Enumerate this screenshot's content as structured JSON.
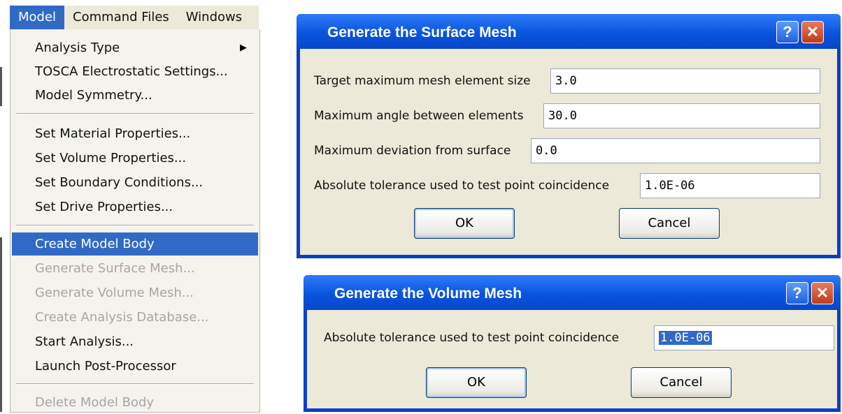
{
  "menubar": {
    "items": [
      "Model",
      "Command Files",
      "Windows"
    ],
    "active_index": 0
  },
  "menu": {
    "items": [
      {
        "label": "Analysis Type",
        "submenu": true
      },
      {
        "label": "TOSCA Electrostatic Settings..."
      },
      {
        "label": "Model Symmetry..."
      },
      {
        "label": "Set Material Properties..."
      },
      {
        "label": "Set Volume Properties..."
      },
      {
        "label": "Set Boundary Conditions..."
      },
      {
        "label": "Set Drive Properties..."
      },
      {
        "label": "Create Model Body",
        "highlighted": true
      },
      {
        "label": "Generate Surface Mesh...",
        "disabled": true
      },
      {
        "label": "Generate Volume Mesh...",
        "disabled": true
      },
      {
        "label": "Create Analysis Database...",
        "disabled": true
      },
      {
        "label": "Start Analysis..."
      },
      {
        "label": "Launch Post-Processor"
      },
      {
        "label": "Delete Model Body",
        "disabled": true
      }
    ],
    "submenu_arrow_icon": "triangle-right-icon"
  },
  "surface_dialog": {
    "title": "Generate the Surface Mesh",
    "fields": [
      {
        "label": "Target maximum mesh element size",
        "value": "3.0"
      },
      {
        "label": "Maximum angle between elements",
        "value": "30.0"
      },
      {
        "label": "Maximum deviation from surface",
        "value": "0.0"
      },
      {
        "label": "Absolute tolerance used to test point coincidence",
        "value": "1.0E-06"
      }
    ],
    "ok": "OK",
    "cancel": "Cancel",
    "help_icon": "question-mark-icon",
    "close_icon": "close-x-icon"
  },
  "volume_dialog": {
    "title": "Generate the Volume Mesh",
    "fields": [
      {
        "label": "Absolute tolerance used to test point coincidence",
        "value": "1.0E-06",
        "selected": true
      }
    ],
    "ok": "OK",
    "cancel": "Cancel",
    "help_icon": "question-mark-icon",
    "close_icon": "close-x-icon"
  },
  "colors": {
    "selection": "#316ac5",
    "titlebar": "#0954df",
    "dialog_face": "#ece9d8",
    "close_button": "#c33b16"
  }
}
